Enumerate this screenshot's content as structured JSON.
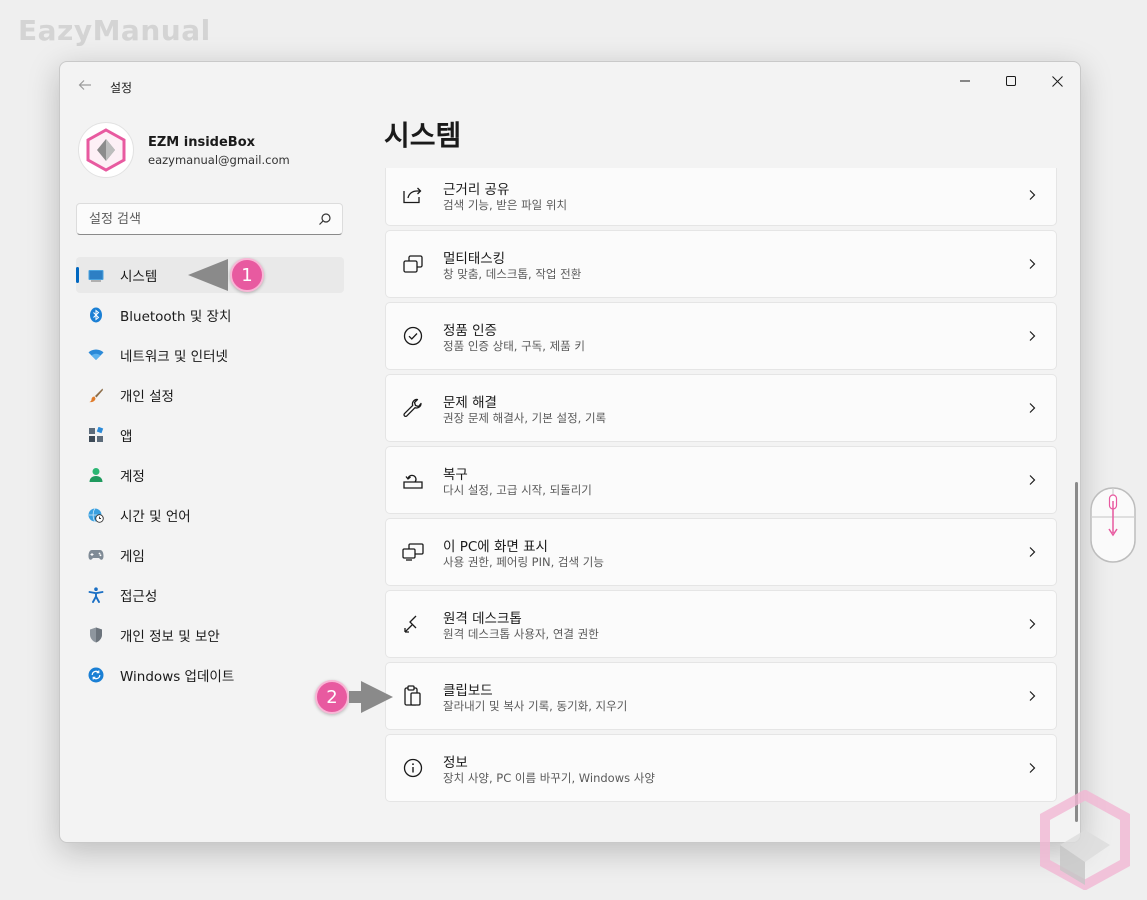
{
  "watermark": "EazyManual",
  "window": {
    "title": "설정"
  },
  "profile": {
    "name": "EZM insideBox",
    "email": "eazymanual@gmail.com"
  },
  "search": {
    "placeholder": "설정 검색"
  },
  "nav": {
    "items": [
      {
        "label": "시스템",
        "icon": "display-icon",
        "active": true
      },
      {
        "label": "Bluetooth 및 장치",
        "icon": "bluetooth-icon"
      },
      {
        "label": "네트워크 및 인터넷",
        "icon": "wifi-icon"
      },
      {
        "label": "개인 설정",
        "icon": "brush-icon"
      },
      {
        "label": "앱",
        "icon": "apps-icon"
      },
      {
        "label": "계정",
        "icon": "person-icon"
      },
      {
        "label": "시간 및 언어",
        "icon": "globe-clock-icon"
      },
      {
        "label": "게임",
        "icon": "gamepad-icon"
      },
      {
        "label": "접근성",
        "icon": "accessibility-icon"
      },
      {
        "label": "개인 정보 및 보안",
        "icon": "shield-icon"
      },
      {
        "label": "Windows 업데이트",
        "icon": "update-icon"
      }
    ]
  },
  "main": {
    "title": "시스템",
    "cards": [
      {
        "title": "근거리 공유",
        "subtitle": "검색 기능, 받은 파일 위치",
        "icon": "share-icon"
      },
      {
        "title": "멀티태스킹",
        "subtitle": "창 맞춤, 데스크톱, 작업 전환",
        "icon": "multitask-icon"
      },
      {
        "title": "정품 인증",
        "subtitle": "정품 인증 상태, 구독, 제품 키",
        "icon": "check-circle-icon"
      },
      {
        "title": "문제 해결",
        "subtitle": "권장 문제 해결사, 기본 설정, 기록",
        "icon": "wrench-icon"
      },
      {
        "title": "복구",
        "subtitle": "다시 설정, 고급 시작, 되돌리기",
        "icon": "recovery-icon"
      },
      {
        "title": "이 PC에 화면 표시",
        "subtitle": "사용 권한, 페어링 PIN, 검색 기능",
        "icon": "project-icon"
      },
      {
        "title": "원격 데스크톱",
        "subtitle": "원격 데스크톱 사용자, 연결 권한",
        "icon": "remote-icon"
      },
      {
        "title": "클립보드",
        "subtitle": "잘라내기 및 복사 기록, 동기화, 지우기",
        "icon": "clipboard-icon"
      },
      {
        "title": "정보",
        "subtitle": "장치 사양, PC 이름 바꾸기, Windows 사양",
        "icon": "info-icon"
      }
    ]
  },
  "annotations": {
    "badge1": "1",
    "badge2": "2",
    "badge_color": "#e85aa0"
  },
  "colors": {
    "accent": "#0067c0",
    "window_bg": "#f3f3f3",
    "card_bg": "#fbfbfb"
  }
}
